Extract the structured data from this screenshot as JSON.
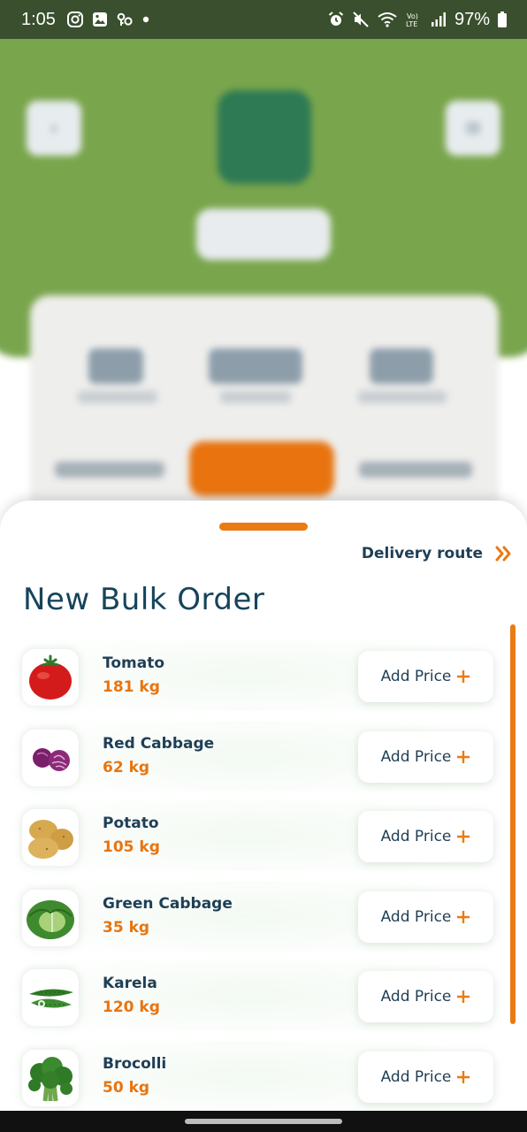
{
  "status_bar": {
    "time": "1:05",
    "battery": "97%",
    "left_icons": [
      "instagram-icon",
      "image-icon",
      "key-icon",
      "dot-icon"
    ],
    "right_icons": [
      "alarm-icon",
      "mute-icon",
      "wifi-icon",
      "volte-icon",
      "signal-icon",
      "battery-icon"
    ]
  },
  "sheet": {
    "delivery_route_label": "Delivery route",
    "title": "New Bulk Order",
    "price_button_label": "Add Price",
    "accent_color": "#e8740f",
    "items": [
      {
        "name": "Tomato",
        "qty": "181 kg",
        "icon": "tomato-icon"
      },
      {
        "name": "Red Cabbage",
        "qty": "62 kg",
        "icon": "red-cabbage-icon"
      },
      {
        "name": "Potato",
        "qty": "105 kg",
        "icon": "potato-icon"
      },
      {
        "name": "Green Cabbage",
        "qty": "35 kg",
        "icon": "green-cabbage-icon"
      },
      {
        "name": "Karela",
        "qty": "120 kg",
        "icon": "karela-icon"
      },
      {
        "name": "Brocolli",
        "qty": "50 kg",
        "icon": "broccoli-icon"
      }
    ]
  }
}
